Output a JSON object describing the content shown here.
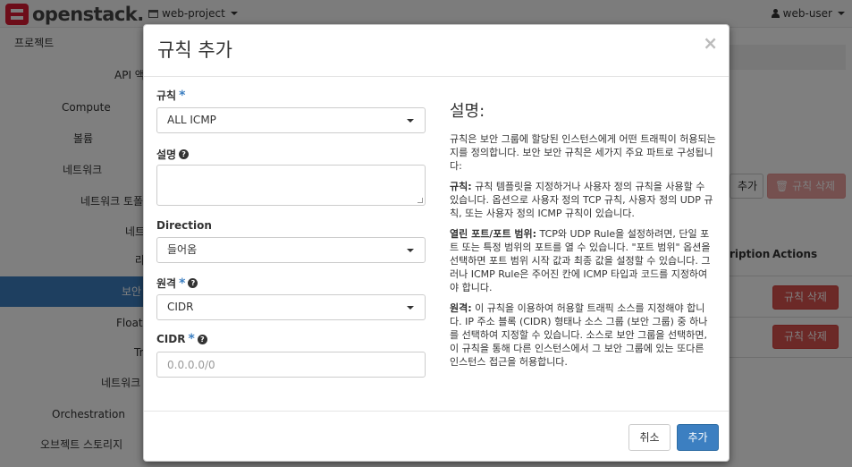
{
  "navbar": {
    "brand": "openstack.",
    "project": "web-project",
    "user": "web-user"
  },
  "sidebar": {
    "items": [
      {
        "label": "프로젝트"
      },
      {
        "label": "API 액"
      },
      {
        "label": "Compute"
      },
      {
        "label": "볼륨"
      },
      {
        "label": "네트워크"
      },
      {
        "label": "네트워크 토폴"
      },
      {
        "label": "네트"
      },
      {
        "label": "라"
      },
      {
        "label": "보안"
      },
      {
        "label": "Floati"
      },
      {
        "label": "Tr"
      },
      {
        "label": "네트워크"
      },
      {
        "label": "Orchestration"
      },
      {
        "label": "오브젝트 스토리지"
      }
    ]
  },
  "background": {
    "add_btn": "추가",
    "delete_btn": "규칙 삭제",
    "col_description": "ription",
    "col_actions": "Actions",
    "row_delete": "규칙 삭제"
  },
  "modal": {
    "title": "규칙 추가",
    "close": "×",
    "fields": {
      "rule": {
        "label": "규칙",
        "required": "*",
        "value": "ALL ICMP"
      },
      "description": {
        "label": "설명",
        "value": ""
      },
      "direction": {
        "label": "Direction",
        "value": "들어옴"
      },
      "remote": {
        "label": "원격",
        "required": "*",
        "value": "CIDR"
      },
      "cidr": {
        "label": "CIDR",
        "required": "*",
        "placeholder": "0.0.0.0/0"
      }
    },
    "help": {
      "title": "설명:",
      "intro": "규칙은 보안 그룹에 할당된 인스턴스에게 어떤 트래픽이 허용되는지를 정의합니다. 보안 보안 규칙은 세가지 주요 파트로 구성됩니다:",
      "rule_term": "규칙:",
      "rule_text": " 규칙 템플릿을 지정하거나 사용자 정의 규칙을 사용할 수 있습니다. 옵션으로 사용자 정의 TCP 규칙, 사용자 정의 UDP 규칙, 또는 사용자 정의 ICMP 규칙이 있습니다.",
      "port_term": "열린 포트/포트 범위:",
      "port_text": " TCP와 UDP Rule을 설정하려면, 단일 포트 또는 특정 범위의 포트를 열 수 있습니다. \"포트 범위\" 옵션을 선택하면 포트 범위 시작 값과 최종 값을 설정할 수 있습니다. 그러나 ICMP Rule은 주어진 칸에 ICMP 타입과 코드를 지정하여야 합니다.",
      "remote_term": "원격:",
      "remote_text": " 이 규칙을 이용하여 허용할 트래픽 소스를 지정해야 합니다. IP 주소 블록 (CIDR) 형태나 소스 그룹 (보안 그룹) 중 하나를 선택하여 지정할 수 있습니다. 소스로 보안 그룹을 선택하면, 이 규칙을 통해 다른 인스턴스에서 그 보안 그룹에 있는 또다른 인스턴스 접근을 허용합니다."
    },
    "footer": {
      "cancel": "취소",
      "submit": "추가"
    }
  }
}
